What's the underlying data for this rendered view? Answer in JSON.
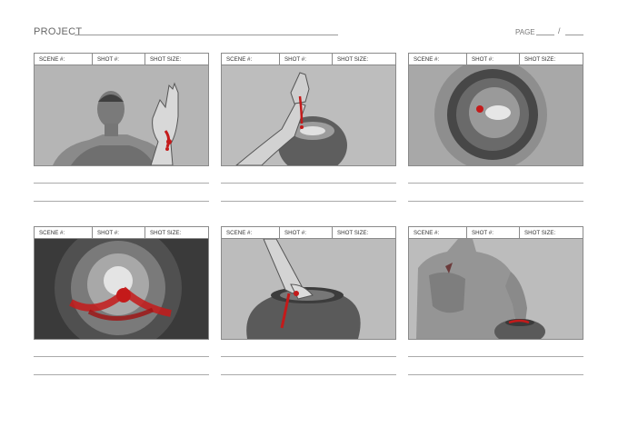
{
  "header": {
    "project_label": "PROJECT",
    "page_label": "PAGE",
    "page_separator": "/"
  },
  "frame_labels": {
    "scene": "SCENE #:",
    "shot": "SHOT #:",
    "shot_size": "SHOT SIZE:"
  },
  "frames": [
    {
      "scene": "SCENE #:",
      "shot": "SHOT #:",
      "shot_size": "SHOT SIZE:",
      "sketch": "man-raising-bleeding-hand"
    },
    {
      "scene": "SCENE #:",
      "shot": "SHOT #:",
      "shot_size": "SHOT SIZE:",
      "sketch": "hand-dripping-blood-into-pot"
    },
    {
      "scene": "SCENE #:",
      "shot": "SHOT #:",
      "shot_size": "SHOT SIZE:",
      "sketch": "top-view-into-pot"
    },
    {
      "scene": "SCENE #:",
      "shot": "SHOT #:",
      "shot_size": "SHOT SIZE:",
      "sketch": "blood-swirl-closeup"
    },
    {
      "scene": "SCENE #:",
      "shot": "SHOT #:",
      "shot_size": "SHOT SIZE:",
      "sketch": "arm-reaching-into-pot"
    },
    {
      "scene": "SCENE #:",
      "shot": "SHOT #:",
      "shot_size": "SHOT SIZE:",
      "sketch": "man-with-hand-in-pot"
    }
  ],
  "colors": {
    "panel_bg": "#b3b3b3",
    "blood": "#c41a1a",
    "line": "#8a8a8a"
  }
}
